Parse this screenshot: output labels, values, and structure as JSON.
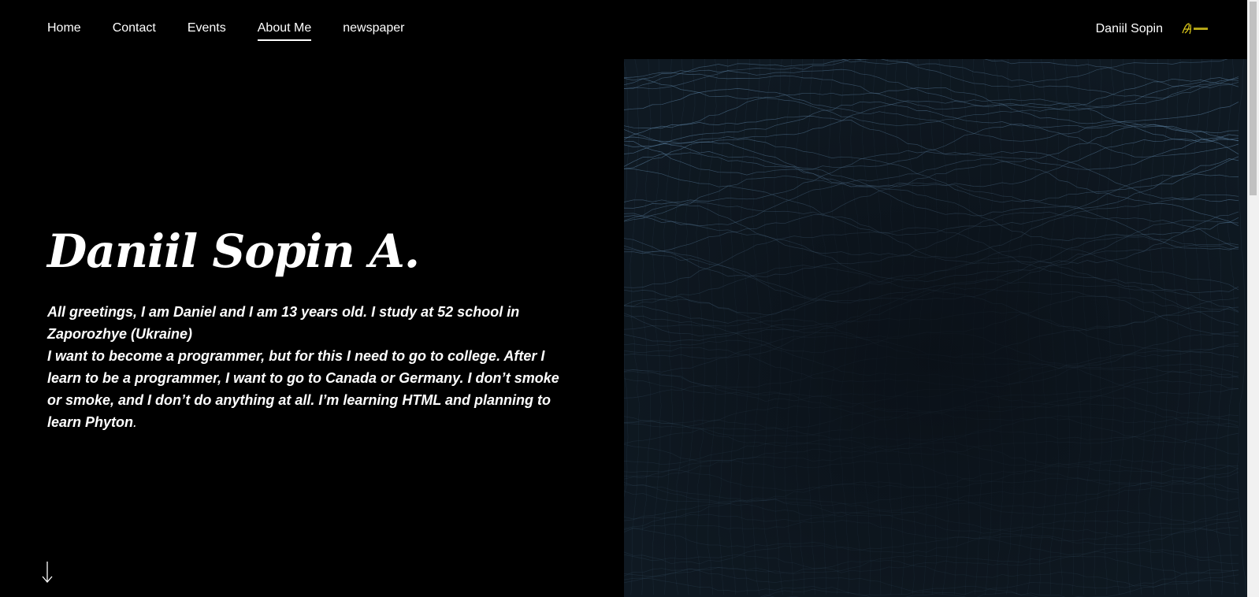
{
  "nav": {
    "items": [
      {
        "label": "Home"
      },
      {
        "label": "Contact"
      },
      {
        "label": "Events"
      },
      {
        "label": "About Me",
        "active": true
      },
      {
        "label": "newspaper"
      }
    ]
  },
  "brand": {
    "name": "Daniil Sopin",
    "logo_icon": "signature-logo-icon",
    "logo_color": "#d4c21a"
  },
  "hero": {
    "title": "Daniil Sopin A.",
    "paragraph_1": "All greetings, I am Daniel and I am 13 years old. I study at 52 school in Zaporozhye (Ukraine)",
    "paragraph_2": "I want to become a programmer, but for this I need to go to college. After I learn to be a programmer, I want to go to Canada or Germany. I don’t smoke or smoke, and I don’t do anything at all. I’m learning HTML and planning to learn Phyton",
    "paragraph_2_end": ".",
    "scroll_icon": "arrow-down-icon"
  },
  "image": {
    "description_icon": "wireframe-waves-image",
    "base_color": "#0f1922",
    "line_color": "#5f86a8"
  }
}
